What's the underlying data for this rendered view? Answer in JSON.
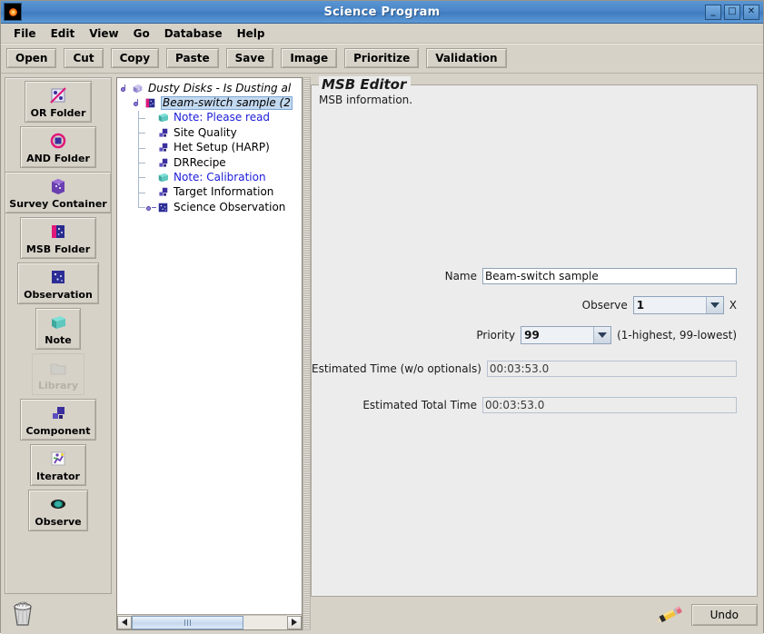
{
  "window": {
    "title": "Science Program",
    "icon": "star-icon",
    "buttons": [
      {
        "name": "minimize-button",
        "glyph": "_"
      },
      {
        "name": "maximize-button",
        "glyph": "□"
      },
      {
        "name": "close-button",
        "glyph": "✕"
      }
    ]
  },
  "menubar": {
    "items": [
      "File",
      "Edit",
      "View",
      "Go",
      "Database",
      "Help"
    ]
  },
  "toolbar": {
    "buttons": [
      "Open",
      "Cut",
      "Copy",
      "Paste",
      "Save",
      "Image",
      "Prioritize",
      "Validation"
    ]
  },
  "palette": {
    "items": [
      {
        "label": "OR Folder",
        "icon": "or-folder-icon",
        "disabled": false,
        "wide": false
      },
      {
        "label": "AND Folder",
        "icon": "and-folder-icon",
        "disabled": false,
        "wide": false
      },
      {
        "label": "Survey Container",
        "icon": "survey-container-icon",
        "disabled": false,
        "wide": true
      },
      {
        "label": "MSB Folder",
        "icon": "msb-folder-icon",
        "disabled": false,
        "wide": false
      },
      {
        "label": "Observation",
        "icon": "observation-icon",
        "disabled": false,
        "wide": false
      },
      {
        "label": "Note",
        "icon": "note-icon",
        "disabled": false,
        "wide": false
      },
      {
        "label": "Library",
        "icon": "library-icon",
        "disabled": true,
        "wide": false
      },
      {
        "label": "Component",
        "icon": "component-icon",
        "disabled": false,
        "wide": false
      },
      {
        "label": "Iterator",
        "icon": "iterator-icon",
        "disabled": false,
        "wide": false
      },
      {
        "label": "Observe",
        "icon": "observe-eye-icon",
        "disabled": false,
        "wide": false
      }
    ],
    "trash": "trash-icon"
  },
  "tree": {
    "nodes": [
      {
        "label": "Dusty Disks - Is Dusting al",
        "icon": "science-program-icon",
        "depth": 0,
        "style": "root",
        "expander": "expanded"
      },
      {
        "label": "Beam-switch sample (2",
        "icon": "msb-folder-icon",
        "depth": 1,
        "style": "selected",
        "expander": "expanded"
      },
      {
        "label": "Note: Please read",
        "icon": "note-icon",
        "depth": 2,
        "style": "note",
        "expander": "none"
      },
      {
        "label": "Site Quality",
        "icon": "component-icon",
        "depth": 2,
        "style": "normal",
        "expander": "none"
      },
      {
        "label": "Het Setup (HARP)",
        "icon": "component-icon",
        "depth": 2,
        "style": "normal",
        "expander": "none"
      },
      {
        "label": "DRRecipe",
        "icon": "component-icon",
        "depth": 2,
        "style": "normal",
        "expander": "none"
      },
      {
        "label": "Note: Calibration",
        "icon": "note-icon",
        "depth": 2,
        "style": "note",
        "expander": "none"
      },
      {
        "label": "Target Information",
        "icon": "component-icon",
        "depth": 2,
        "style": "normal",
        "expander": "none"
      },
      {
        "label": "Science Observation",
        "icon": "observation-icon",
        "depth": 2,
        "style": "normal",
        "expander": "collapsed"
      }
    ],
    "hscroll": {
      "left_arrow": "scroll-left-icon",
      "right_arrow": "scroll-right-icon"
    }
  },
  "editor": {
    "legend": "MSB Editor",
    "subtitle": "MSB information.",
    "fields": {
      "name": {
        "label": "Name",
        "value": "Beam-switch sample"
      },
      "observe": {
        "label": "Observe",
        "value": "1",
        "suffix": "X"
      },
      "priority": {
        "label": "Priority",
        "value": "99",
        "suffix": "(1-highest, 99-lowest)"
      },
      "est_time": {
        "label": "Estimated Time (w/o optionals)",
        "value": "00:03:53.0"
      },
      "est_total_time": {
        "label": "Estimated Total Time",
        "value": "00:03:53.0"
      }
    }
  },
  "bottom": {
    "pencil": "pencil-icon",
    "undo_label": "Undo"
  },
  "colors": {
    "titlebar": "#4a86c8",
    "panel": "#d6d2c8",
    "editor_bg": "#ececec",
    "note_text": "#1b1bd8",
    "selection": "#c3d9f0"
  }
}
